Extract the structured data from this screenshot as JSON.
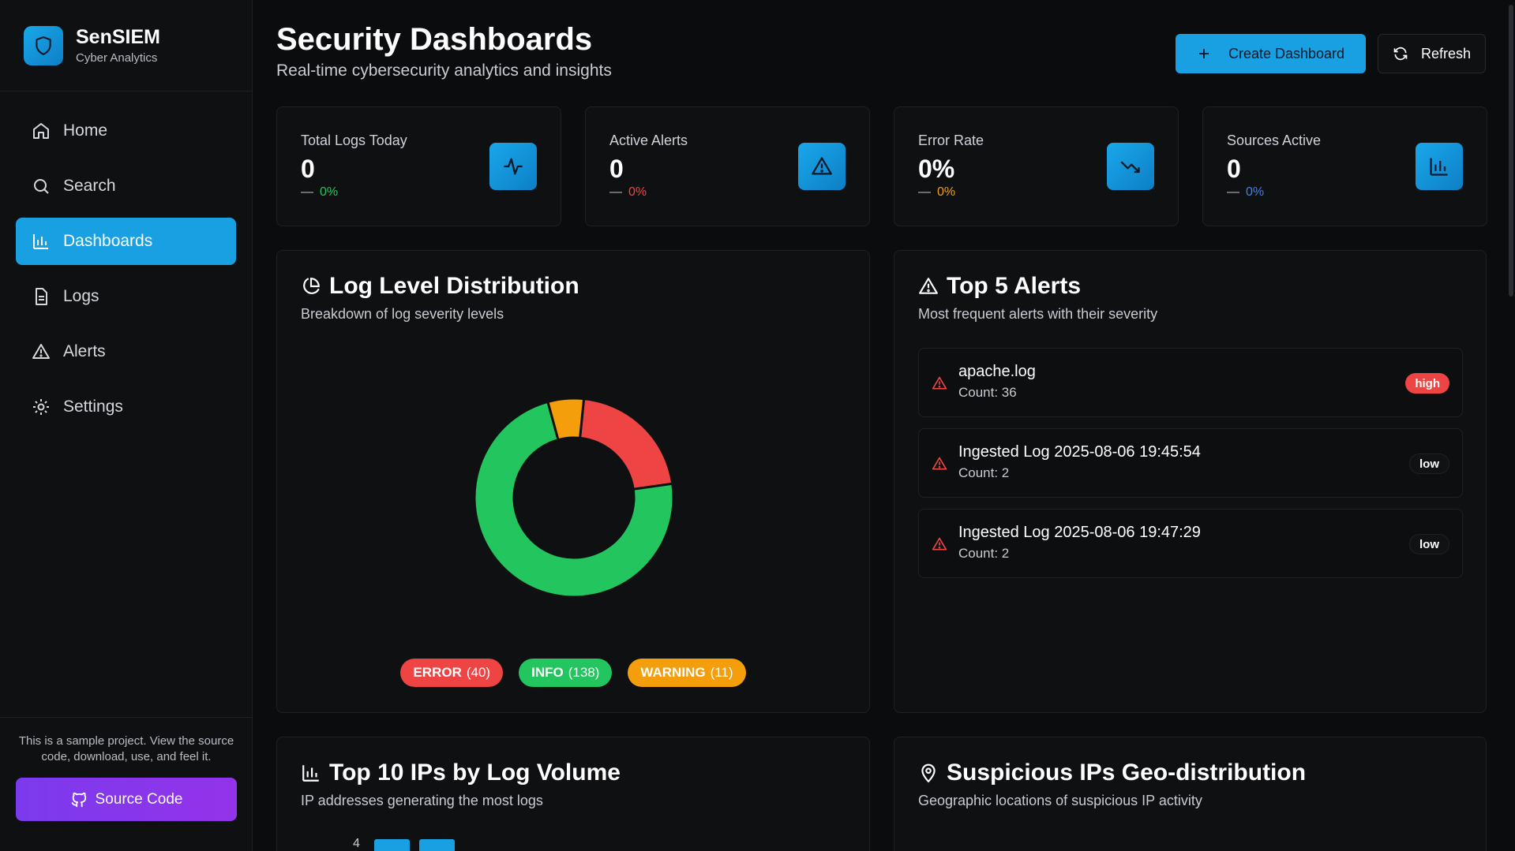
{
  "brand": {
    "name": "SenSIEM",
    "subtitle": "Cyber Analytics"
  },
  "nav": [
    {
      "label": "Home",
      "icon": "home-icon"
    },
    {
      "label": "Search",
      "icon": "search-icon"
    },
    {
      "label": "Dashboards",
      "icon": "bar-chart-icon",
      "active": true
    },
    {
      "label": "Logs",
      "icon": "file-text-icon"
    },
    {
      "label": "Alerts",
      "icon": "alert-triangle-icon"
    },
    {
      "label": "Settings",
      "icon": "gear-icon"
    }
  ],
  "footer": {
    "note": "This is a sample project. View the source code, download, use, and feel it.",
    "source_label": "Source Code"
  },
  "header": {
    "title": "Security Dashboards",
    "subtitle": "Real-time cybersecurity analytics and insights",
    "create_label": "Create Dashboard",
    "refresh_label": "Refresh"
  },
  "stats": [
    {
      "label": "Total Logs Today",
      "value": "0",
      "delta": "0%",
      "delta_color": "#22c55e",
      "icon": "activity-icon"
    },
    {
      "label": "Active Alerts",
      "value": "0",
      "delta": "0%",
      "delta_color": "#ef4444",
      "icon": "alert-triangle-icon"
    },
    {
      "label": "Error Rate",
      "value": "0%",
      "delta": "0%",
      "delta_color": "#f59e0b",
      "icon": "trending-down-icon"
    },
    {
      "label": "Sources Active",
      "value": "0",
      "delta": "0%",
      "delta_color": "#3b82f6",
      "icon": "bar-chart-icon"
    }
  ],
  "distribution": {
    "title": "Log Level Distribution",
    "subtitle": "Breakdown of log severity levels"
  },
  "chart_data": {
    "type": "pie",
    "categories": [
      "ERROR",
      "INFO",
      "WARNING"
    ],
    "values": [
      40,
      138,
      11
    ],
    "colors": [
      "#ef4444",
      "#22c55e",
      "#f59e0b"
    ],
    "legend": "bottom"
  },
  "legend_labels": [
    "(40)",
    "(138)",
    "(11)"
  ],
  "alerts_panel": {
    "title": "Top 5 Alerts",
    "subtitle": "Most frequent alerts with their severity",
    "items": [
      {
        "name": "apache.log",
        "count": "Count: 36",
        "severity": "high"
      },
      {
        "name": "Ingested Log 2025-08-06 19:45:54",
        "count": "Count: 2",
        "severity": "low"
      },
      {
        "name": "Ingested Log 2025-08-06 19:47:29",
        "count": "Count: 2",
        "severity": "low"
      }
    ]
  },
  "ips_panel": {
    "title": "Top 10 IPs by Log Volume",
    "subtitle": "IP addresses generating the most logs",
    "y_tick_top": "4"
  },
  "geo_panel": {
    "title": "Suspicious IPs Geo-distribution",
    "subtitle": "Geographic locations of suspicious IP activity"
  }
}
